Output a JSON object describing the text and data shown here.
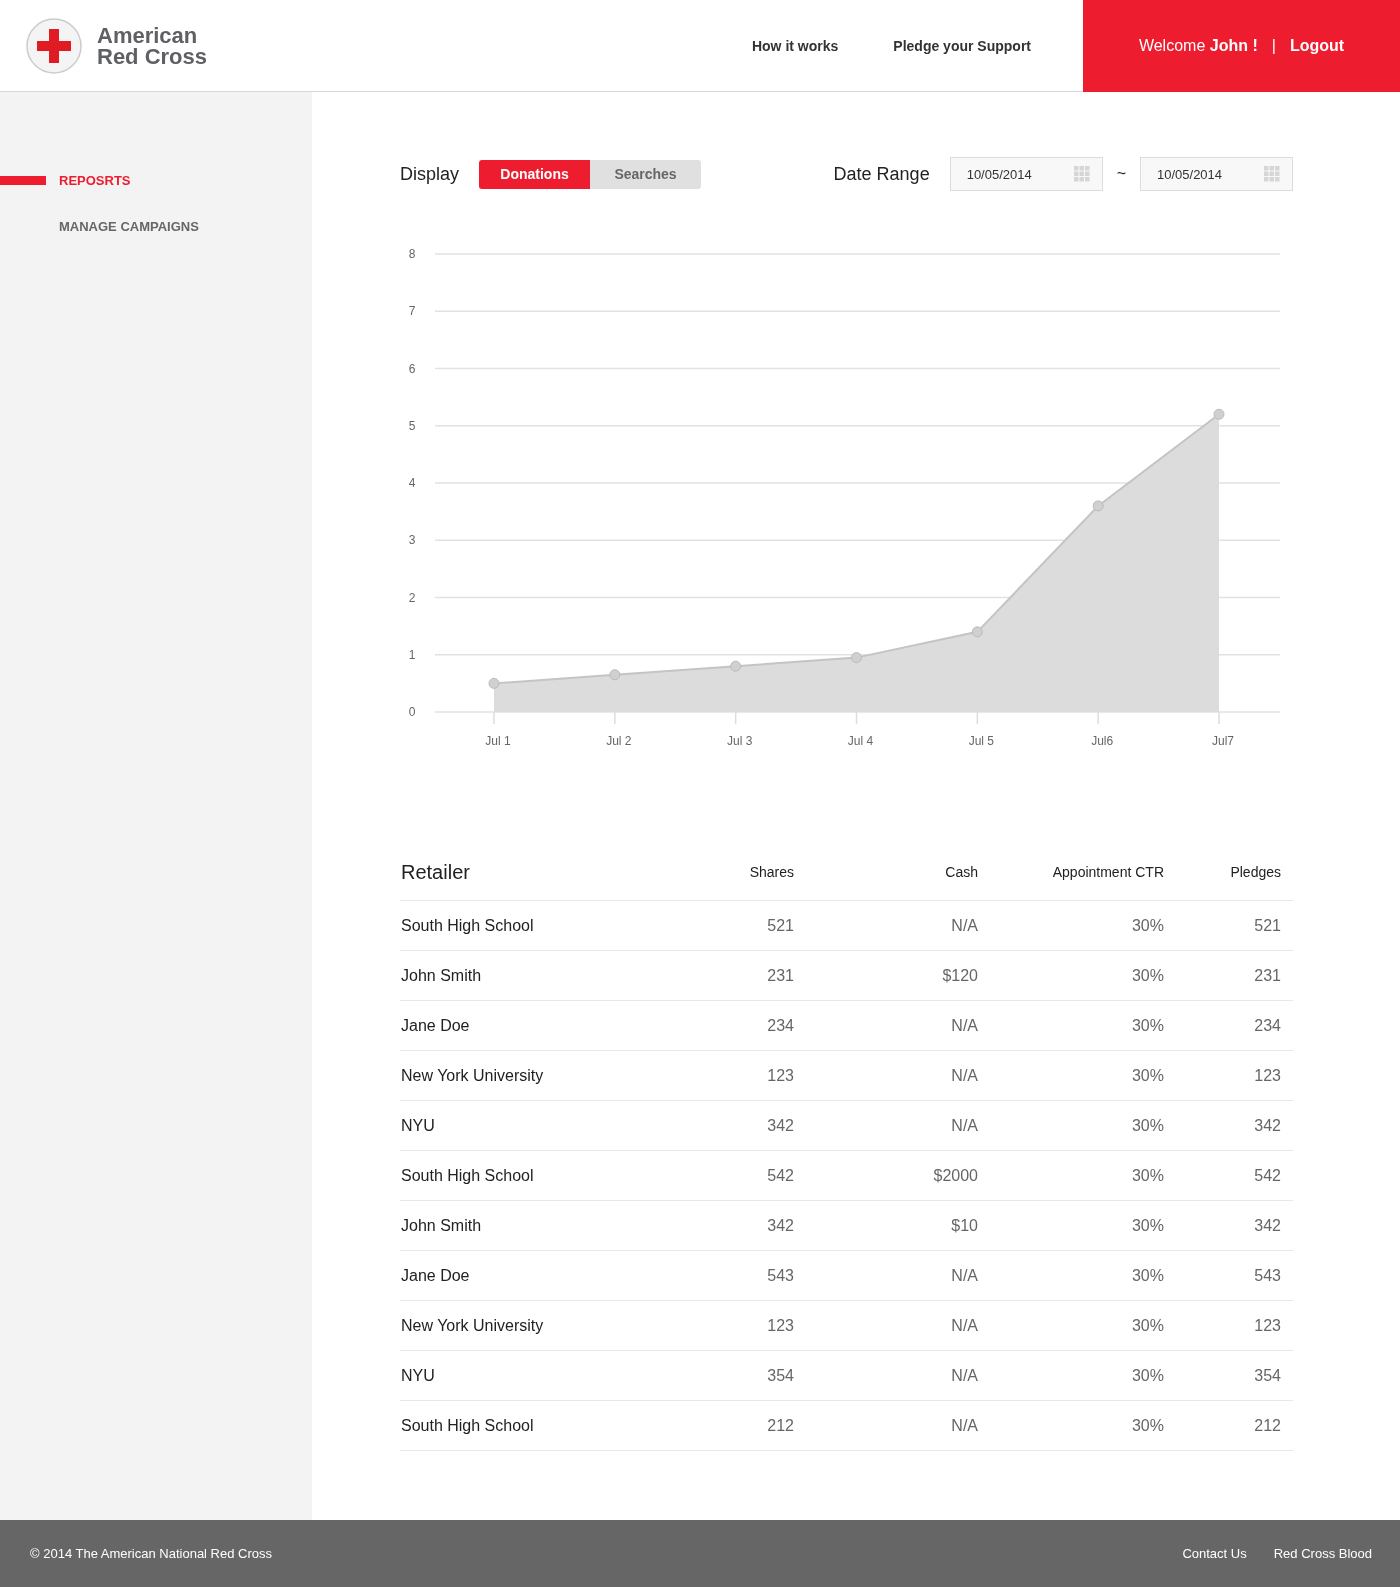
{
  "header": {
    "logo_line_1": "American",
    "logo_line_2": "Red Cross",
    "nav": [
      "How it works",
      "Pledge your Support"
    ],
    "welcome": "Welcome **John !**",
    "separator": "|",
    "logout": "Logout"
  },
  "sidebar": {
    "items": [
      {
        "label": "REPOSRTS",
        "selected": true
      },
      {
        "label": "MANAGE CAMPAIGNS",
        "selected": false
      }
    ]
  },
  "display": {
    "label": "Display",
    "options": [
      {
        "label": "Donations",
        "selected": true
      },
      {
        "label": "Searches",
        "selected": false
      }
    ]
  },
  "date_range": {
    "label": "Date Range",
    "from": "10/05/2014",
    "separator": "~",
    "to": "10/05/2014"
  },
  "chart_data": {
    "type": "area",
    "categories": [
      "Jul 1",
      "Jul 2",
      "Jul 3",
      "Jul 4",
      "Jul 5",
      "Jul6",
      "Jul7"
    ],
    "series": [
      {
        "color": "#dcdcdc",
        "values": [
          0.5,
          0.65,
          0.8,
          0.95,
          1.4,
          3.6,
          5.2
        ]
      }
    ],
    "grid": true,
    "ylim": [
      0,
      8
    ],
    "yticks": [
      0,
      1,
      2,
      3,
      4,
      5,
      6,
      7,
      8
    ]
  },
  "table": {
    "columns": [
      "Retailer",
      "Shares",
      "Cash",
      "Appointment CTR",
      "Pledges"
    ],
    "rows": [
      [
        "South High School",
        "521",
        "N/A",
        "30%",
        "521"
      ],
      [
        "John Smith",
        "231",
        "$120",
        "30%",
        "231"
      ],
      [
        "Jane Doe",
        "234",
        "N/A",
        "30%",
        "234"
      ],
      [
        "New York University",
        "123",
        "N/A",
        "30%",
        "123"
      ],
      [
        "NYU",
        "342",
        "N/A",
        "30%",
        "342"
      ],
      [
        "South High School",
        "542",
        "$2000",
        "30%",
        "542"
      ],
      [
        "John Smith",
        "342",
        "$10",
        "30%",
        "342"
      ],
      [
        "Jane Doe",
        "543",
        "N/A",
        "30%",
        "543"
      ],
      [
        "New York University",
        "123",
        "N/A",
        "30%",
        "123"
      ],
      [
        "NYU",
        "354",
        "N/A",
        "30%",
        "354"
      ],
      [
        "South High School",
        "212",
        "N/A",
        "30%",
        "212"
      ]
    ]
  },
  "footer": {
    "copyright": "© 2014 The American National Red Cross",
    "links": [
      "Contact Us",
      "Red Cross Blood"
    ]
  }
}
